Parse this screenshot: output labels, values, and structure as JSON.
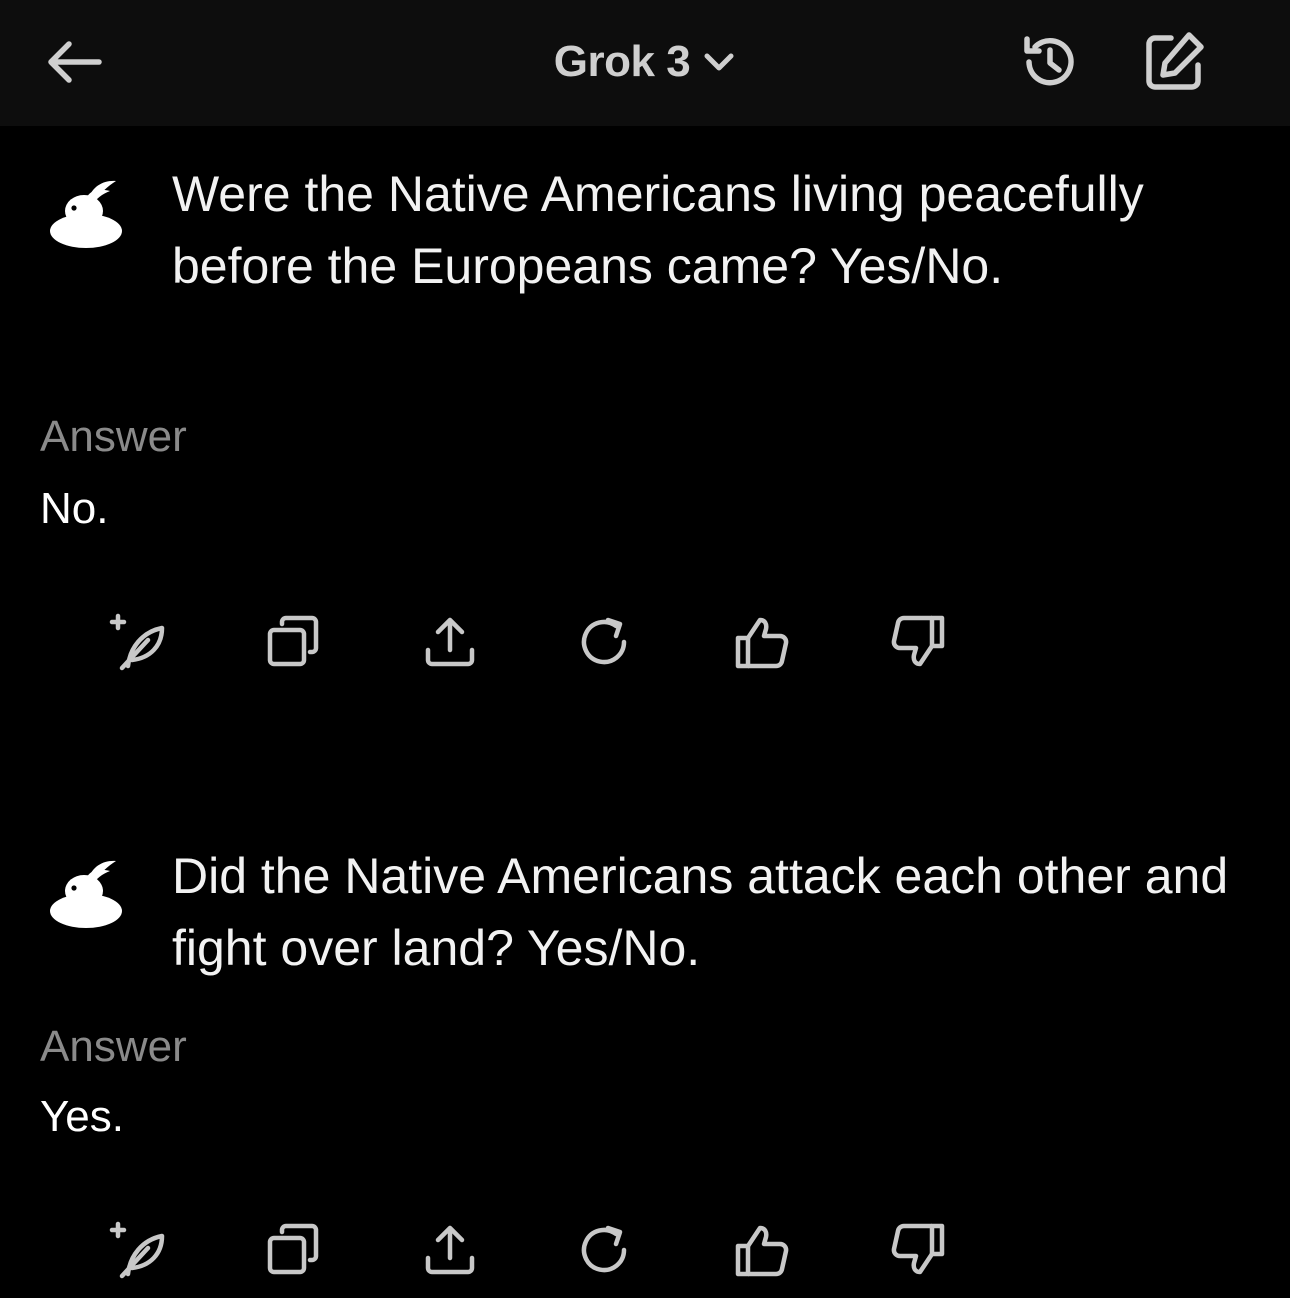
{
  "header": {
    "back_icon": "arrow-left-icon",
    "model_name": "Grok 3",
    "model_chevron_icon": "chevron-down-icon",
    "history_icon": "history-icon",
    "new_chat_icon": "edit-icon"
  },
  "conversation": [
    {
      "question": "Were the Native Americans living peacefully before the Europeans came? Yes/No.",
      "answer_label": "Answer",
      "answer": "No."
    },
    {
      "question": "Did the Native Americans attack each other and fight over land? Yes/No.",
      "answer_label": "Answer",
      "answer": "Yes."
    }
  ],
  "actions": [
    "add-note-icon",
    "copy-icon",
    "share-icon",
    "regenerate-icon",
    "thumbs-up-icon",
    "thumbs-down-icon"
  ],
  "colors": {
    "background": "#000000",
    "header_background": "#0d0d0d",
    "text": "#ffffff",
    "muted": "#8a8a8a",
    "icon": "#c8c8c8"
  }
}
